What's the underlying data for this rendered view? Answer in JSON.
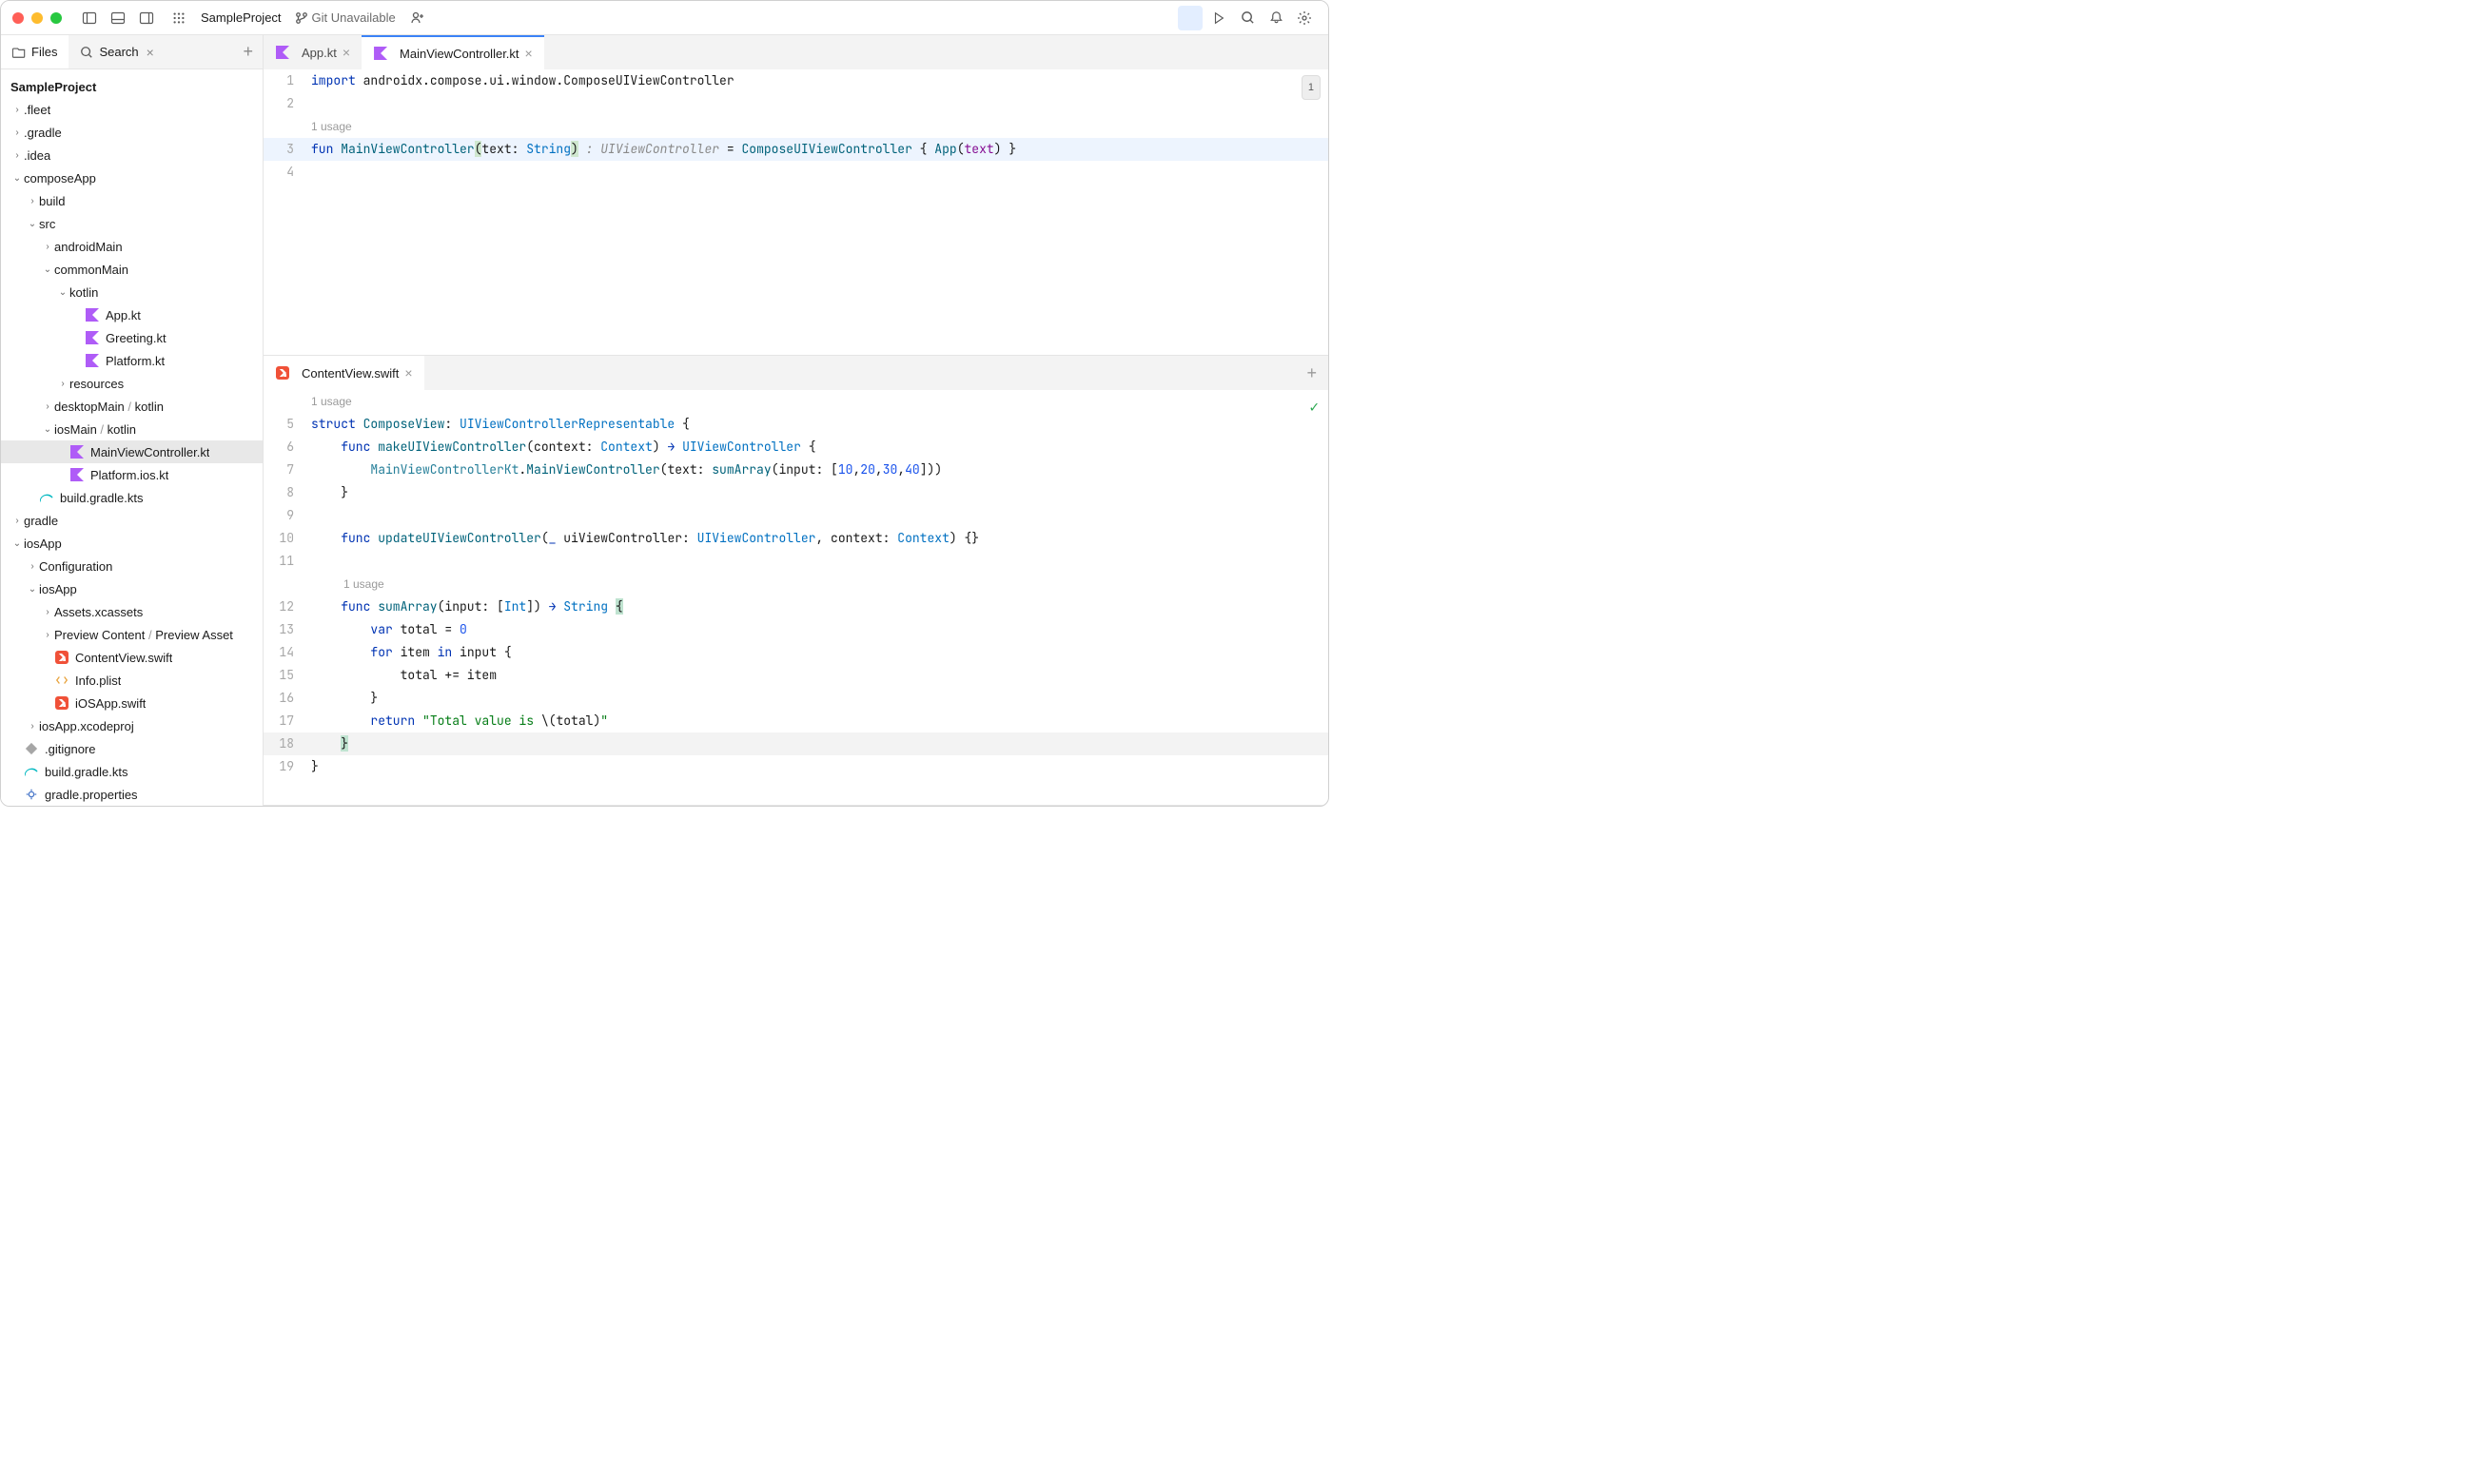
{
  "titlebar": {
    "project": "SampleProject",
    "git": "Git Unavailable"
  },
  "sidebar": {
    "tabs": {
      "files": "Files",
      "search": "Search"
    },
    "root": "SampleProject",
    "nodes": {
      "fleet": ".fleet",
      "gradle_dot": ".gradle",
      "idea": ".idea",
      "composeApp": "composeApp",
      "build": "build",
      "src": "src",
      "androidMain": "androidMain",
      "commonMain": "commonMain",
      "kotlin": "kotlin",
      "appkt": "App.kt",
      "greetingkt": "Greeting.kt",
      "platformkt": "Platform.kt",
      "resources": "resources",
      "desktopMain": "desktopMain",
      "desktopMain_sub": "kotlin",
      "iosMain": "iosMain",
      "iosMain_sub": "kotlin",
      "mainvc": "MainViewController.kt",
      "platformios": "Platform.ios.kt",
      "buildgradle": "build.gradle.kts",
      "gradle": "gradle",
      "iosApp": "iosApp",
      "configuration": "Configuration",
      "iosApp2": "iosApp",
      "assets": "Assets.xcassets",
      "preview": "Preview Content",
      "preview_sub": "Preview Asset",
      "contentview": "ContentView.swift",
      "infoplist": "Info.plist",
      "iosappswift": "iOSApp.swift",
      "xcodeproj": "iosApp.xcodeproj",
      "gitignore": ".gitignore",
      "buildgradle2": "build.gradle.kts",
      "gradleprops": "gradle.properties"
    }
  },
  "editor_top": {
    "tabs": {
      "appkt": "App.kt",
      "mainvc": "MainViewController.kt"
    },
    "badge": "1",
    "usage": "1 usage",
    "lines": {
      "l1a": "import",
      "l1b": " androidx.compose.ui.window.ComposeUIViewController",
      "l3_fun": "fun ",
      "l3_name": "MainViewController",
      "l3_p1": "(",
      "l3_arg": "text",
      "l3_colon": ": ",
      "l3_type": "String",
      "l3_p2": ")",
      "l3_hint": " : UIViewController",
      "l3_eq": " = ",
      "l3_call": "ComposeUIViewController",
      "l3_b1": " { ",
      "l3_app": "App",
      "l3_p3": "(",
      "l3_arg2": "text",
      "l3_p4": ")",
      "l3_b2": " }"
    }
  },
  "editor_bottom": {
    "tab": "ContentView.swift",
    "usage1": "1 usage",
    "usage2": "1 usage",
    "lines": {
      "l5_a": "struct ",
      "l5_b": "ComposeView",
      "l5_c": ": ",
      "l5_d": "UIViewControllerRepresentable",
      "l5_e": " {",
      "l6_a": "    func ",
      "l6_b": "makeUIViewController",
      "l6_c": "(context: ",
      "l6_d": "Context",
      "l6_e": ") ",
      "l6_arrow": "→",
      "l6_f": " ",
      "l6_g": "UIViewController",
      "l6_h": " {",
      "l7_a": "        ",
      "l7_b": "MainViewControllerKt",
      "l7_c": ".",
      "l7_d": "MainViewController",
      "l7_e": "(text: ",
      "l7_f": "sumArray",
      "l7_g": "(input: [",
      "l7_n1": "10",
      "l7_s1": ",",
      "l7_n2": "20",
      "l7_s2": ",",
      "l7_n3": "30",
      "l7_s3": ",",
      "l7_n4": "40",
      "l7_h": "]))",
      "l8": "    }",
      "l10_a": "    func ",
      "l10_b": "updateUIViewController",
      "l10_c": "(",
      "l10_d": "_",
      "l10_e": " uiViewController: ",
      "l10_f": "UIViewController",
      "l10_g": ", context: ",
      "l10_h": "Context",
      "l10_i": ") {}",
      "l12_a": "    func ",
      "l12_b": "sumArray",
      "l12_c": "(input: [",
      "l12_d": "Int",
      "l12_e": "]) ",
      "l12_arrow": "→",
      "l12_f": " ",
      "l12_g": "String",
      "l12_h": " ",
      "l12_brace": "{",
      "l13_a": "        var ",
      "l13_b": "total",
      "l13_c": " = ",
      "l13_d": "0",
      "l14_a": "        for ",
      "l14_b": "item",
      "l14_c": " in ",
      "l14_d": "input {",
      "l15": "            total += item",
      "l16": "        }",
      "l17_a": "        return ",
      "l17_b": "\"Total value is ",
      "l17_c": "\\(",
      "l17_d": "total",
      "l17_e": ")",
      "l17_f": "\"",
      "l18": "    ",
      "l18_brace": "}",
      "l19": "}"
    }
  }
}
